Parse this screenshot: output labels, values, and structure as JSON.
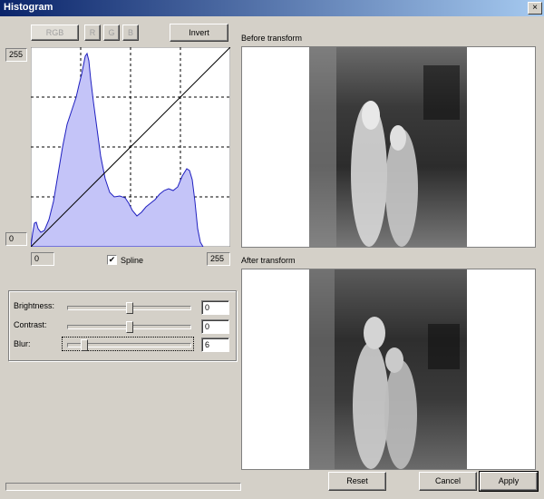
{
  "window": {
    "title": "Histogram",
    "close_glyph": "×"
  },
  "channels": {
    "rgb": "RGB",
    "r": "R",
    "g": "G",
    "b": "B"
  },
  "invert_label": "Invert",
  "histogram": {
    "y_max_label": "255",
    "y_min_label": "0",
    "x_min_label": "0",
    "x_max_label": "255"
  },
  "spline": {
    "label": "Spline",
    "checked": true,
    "check_glyph": "✔"
  },
  "adjust": {
    "brightness": {
      "label": "Brightness:",
      "value": "0",
      "level": 0.5
    },
    "contrast": {
      "label": "Contrast:",
      "value": "0",
      "level": 0.5
    },
    "blur": {
      "label": "Blur:",
      "value": "6",
      "level": 0.12
    }
  },
  "preview": {
    "before_label": "Before transform",
    "after_label": "After transform"
  },
  "buttons": {
    "reset": "Reset",
    "cancel": "Cancel",
    "apply": "Apply"
  },
  "colors": {
    "histogram_fill": "#c4c4f8",
    "histogram_stroke": "#2020c0",
    "accent_title": "#0a246a"
  }
}
